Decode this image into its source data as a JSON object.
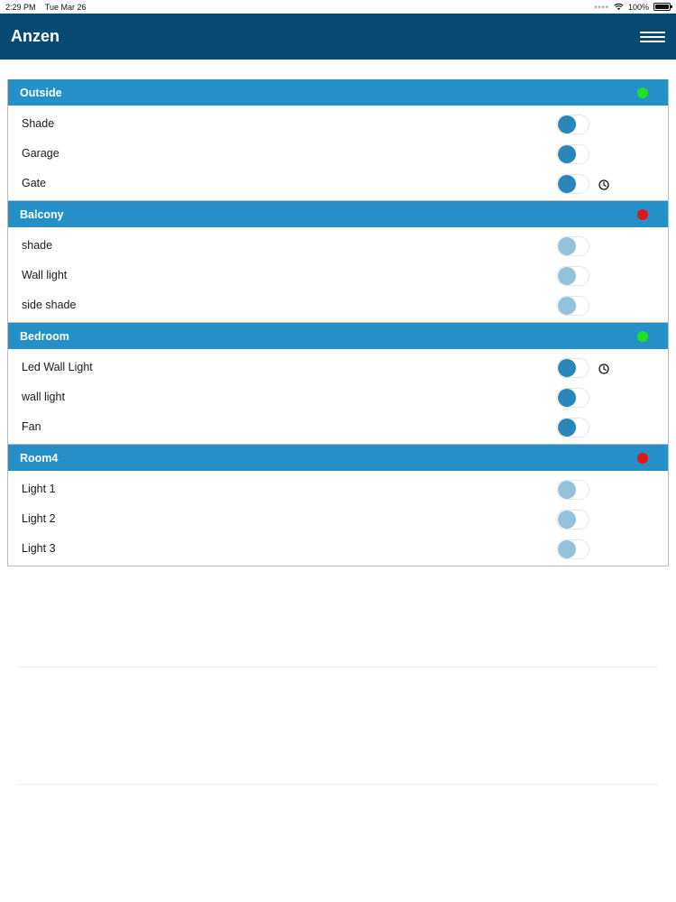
{
  "status_bar": {
    "time": "2:29 PM",
    "date": "Tue Mar 26",
    "battery": "100%"
  },
  "app": {
    "title": "Anzen"
  },
  "colors": {
    "app_bar": "#064a73",
    "room_header": "#2590c8",
    "toggle_knob_on": "#2a85b9",
    "toggle_knob_disabled": "#93c2dc",
    "status_online": "#22e022",
    "status_offline": "#e41515"
  },
  "rooms": [
    {
      "name": "Outside",
      "status": "online",
      "devices": [
        {
          "name": "Shade",
          "enabled": true,
          "timer": false
        },
        {
          "name": "Garage",
          "enabled": true,
          "timer": false
        },
        {
          "name": "Gate",
          "enabled": true,
          "timer": true
        }
      ]
    },
    {
      "name": "Balcony",
      "status": "offline",
      "devices": [
        {
          "name": "shade",
          "enabled": false,
          "timer": false
        },
        {
          "name": "Wall light",
          "enabled": false,
          "timer": false
        },
        {
          "name": "side shade",
          "enabled": false,
          "timer": false
        }
      ]
    },
    {
      "name": "Bedroom",
      "status": "online",
      "devices": [
        {
          "name": "Led Wall Light",
          "enabled": true,
          "timer": true
        },
        {
          "name": "wall light",
          "enabled": true,
          "timer": false
        },
        {
          "name": "Fan",
          "enabled": true,
          "timer": false
        }
      ]
    },
    {
      "name": "Room4",
      "status": "offline",
      "devices": [
        {
          "name": "Light 1",
          "enabled": false,
          "timer": false
        },
        {
          "name": "Light 2",
          "enabled": false,
          "timer": false
        },
        {
          "name": "Light 3",
          "enabled": false,
          "timer": false
        }
      ]
    }
  ]
}
